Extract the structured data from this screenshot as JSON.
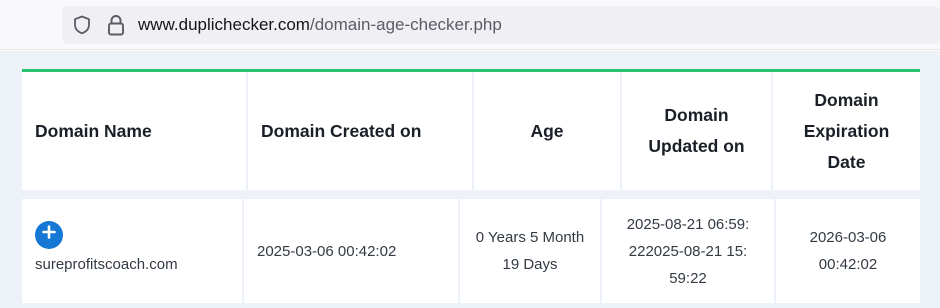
{
  "browser": {
    "url_domain": "www.duplichecker.com",
    "url_path": "/domain-age-checker.php"
  },
  "table": {
    "headers": [
      "Domain Name",
      "Domain Created on",
      "Age",
      "Domain Updated on",
      "Domain Expiration Date"
    ],
    "row": {
      "domain_name": "sureprofitscoach.com",
      "created_on": "2025-03-06 00:42:02",
      "age": "0 Years 5 Month 19 Days",
      "updated_on": "2025-08-21 06:59:222025-08-21 15:59:22",
      "expiration_date": "2026-03-06 00:42:02"
    }
  },
  "colors": {
    "accent_green": "#27c26c",
    "expand_button_blue": "#1478d4"
  },
  "icons": {
    "site_info": "shield-icon",
    "security": "lock-icon",
    "expand": "plus-circle-icon"
  }
}
